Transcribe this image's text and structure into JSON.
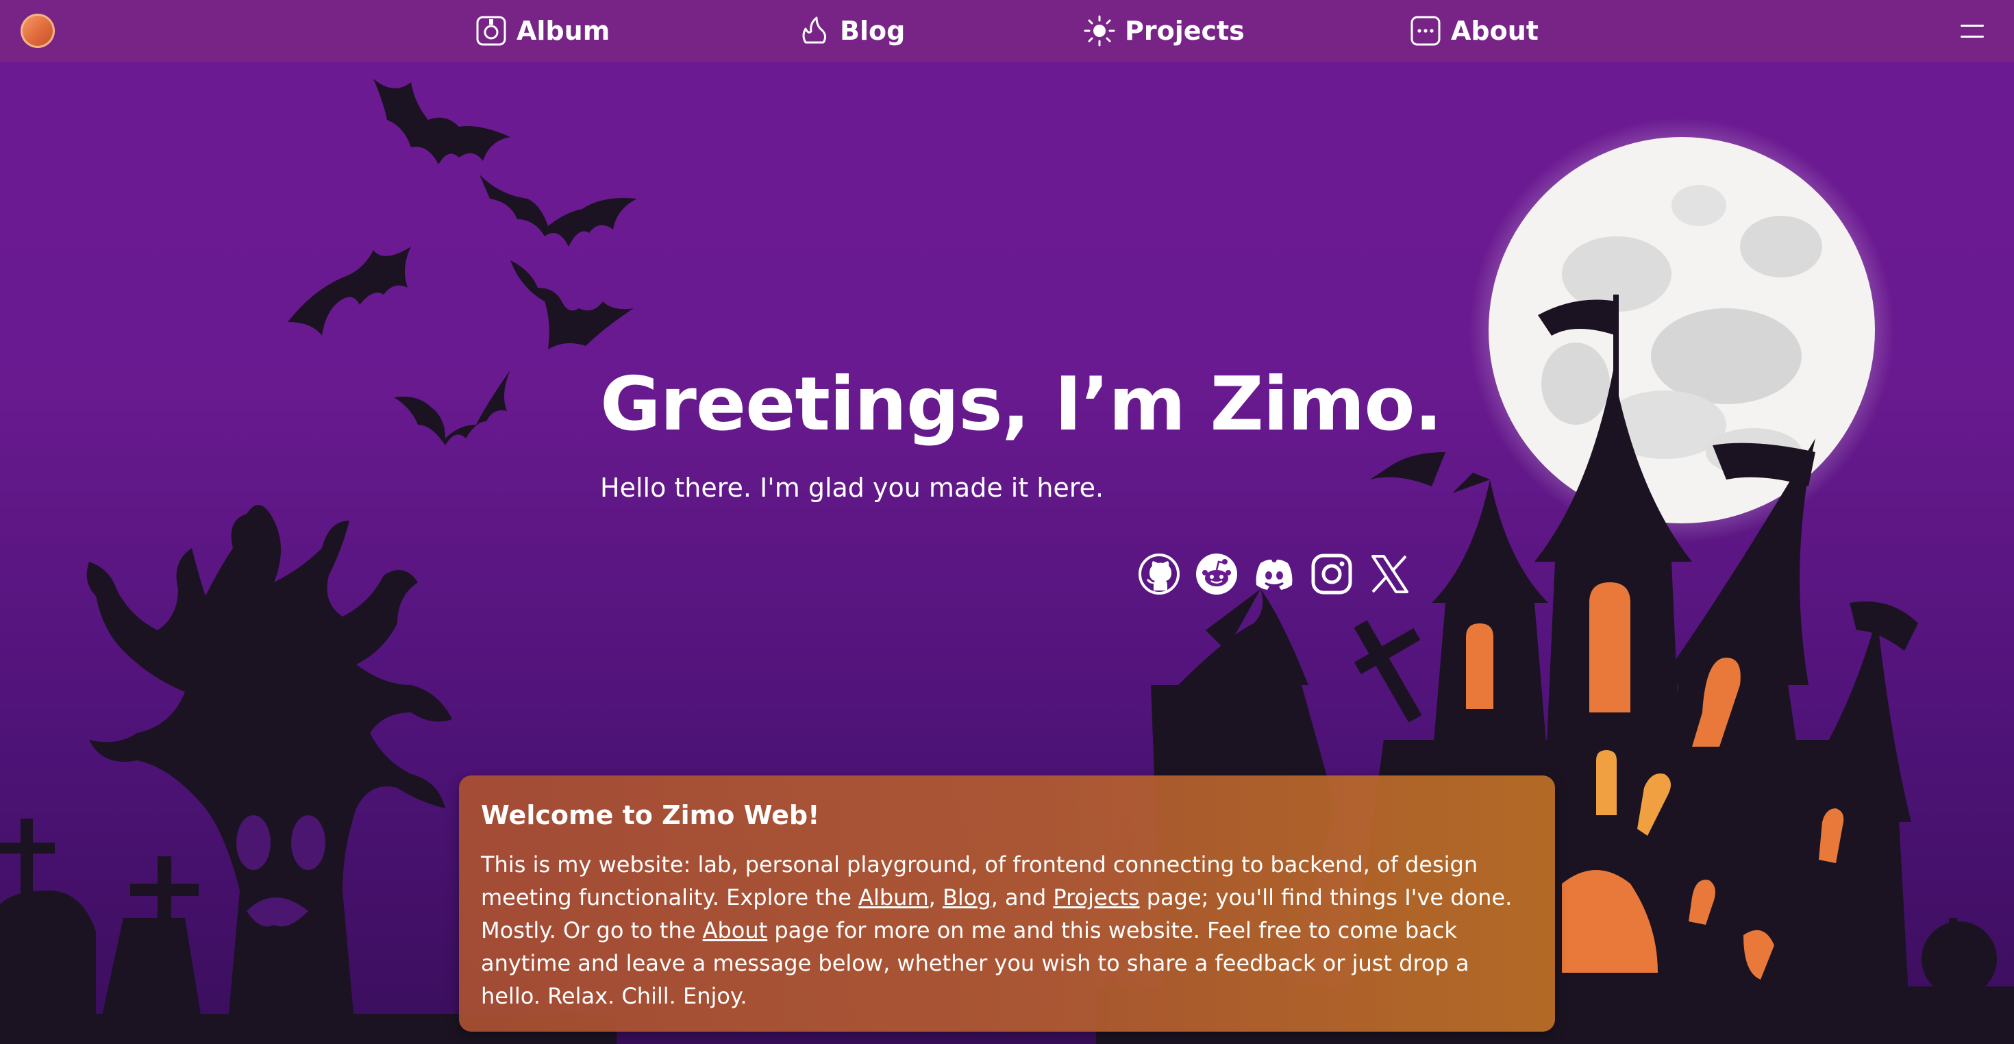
{
  "nav": {
    "items": [
      {
        "label": "Album",
        "icon": "album-icon"
      },
      {
        "label": "Blog",
        "icon": "blog-icon"
      },
      {
        "label": "Projects",
        "icon": "projects-icon"
      },
      {
        "label": "About",
        "icon": "about-icon"
      }
    ],
    "menu_icon": "hamburger-menu-icon",
    "logo_icon": "site-logo-icon"
  },
  "hero": {
    "title": "Greetings, I’m Zimo.",
    "subtitle": "Hello there. I'm glad you made it here."
  },
  "socials": [
    "github-icon",
    "reddit-icon",
    "discord-icon",
    "instagram-icon",
    "x-icon"
  ],
  "welcome": {
    "title": "Welcome to Zimo Web!",
    "text_1": "This is my website: lab, personal playground, of frontend connecting to backend, of design meeting functionality. Explore the ",
    "link_album": "Album",
    "sep_1": ", ",
    "link_blog": "Blog",
    "sep_2": ", and ",
    "link_projects": "Projects",
    "text_2": " page; you'll find things I've done. Mostly. Or go to the ",
    "link_about": "About",
    "text_3": " page for more on me and this website. Feel free to come back anytime and leave a message below, whether you wish to share a feedback or just drop a hello. Relax. Chill. Enjoy."
  },
  "colors": {
    "navbar": "#782487",
    "background_top": "#6c1a92",
    "background_bottom": "#3a0e5c",
    "silhouette": "#1b1322",
    "window_orange": "#e8793a",
    "card": "#b05a32"
  }
}
